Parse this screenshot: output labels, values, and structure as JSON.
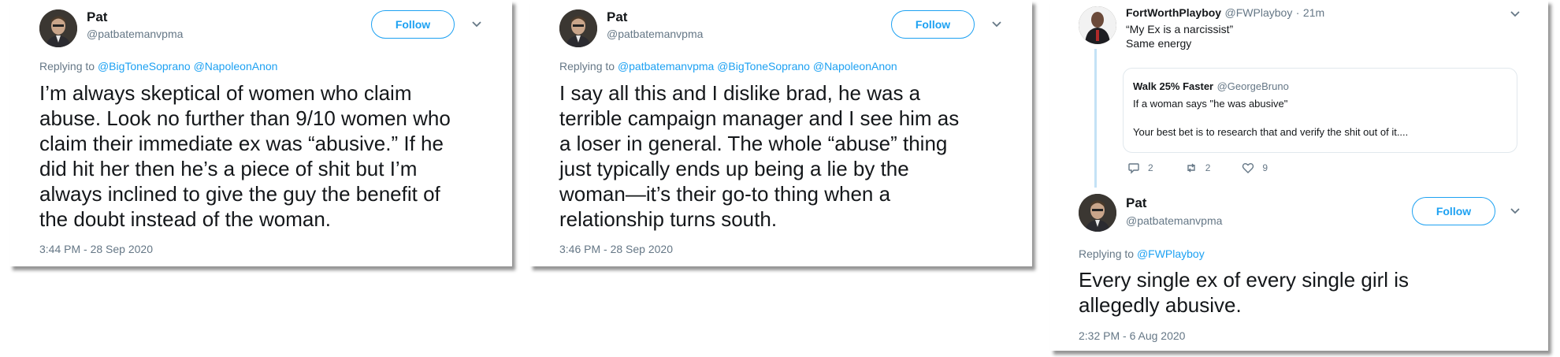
{
  "tweet1": {
    "name": "Pat",
    "handle": "@patbatemanvpma",
    "follow_label": "Follow",
    "replying_prefix": "Replying to",
    "replying_to": [
      "@BigToneSoprano",
      "@NapoleonAnon"
    ],
    "lines": [
      "I’m always skeptical of women who claim",
      "abuse. Look no further than 9/10 women who",
      "claim their immediate ex was “abusive.” If he",
      "did hit her then he’s a piece of shit but I’m",
      "always inclined to give the guy the benefit of",
      "the doubt instead of the woman."
    ],
    "timestamp": "3:44 PM - 28 Sep 2020"
  },
  "tweet2": {
    "name": "Pat",
    "handle": "@patbatemanvpma",
    "follow_label": "Follow",
    "replying_prefix": "Replying to",
    "replying_to": [
      "@patbatemanvpma",
      "@BigToneSoprano",
      "@NapoleonAnon"
    ],
    "lines": [
      "I say all this and I dislike brad, he was a",
      "terrible campaign manager and I see him as",
      "a loser in general. The whole “abuse” thing",
      "just typically ends up being a lie by the",
      "woman—it’s their go-to thing when a",
      "relationship turns south."
    ],
    "timestamp": "3:46 PM - 28 Sep 2020"
  },
  "tweet3": {
    "parent": {
      "name": "FortWorthPlayboy",
      "handle": "@FWPlayboy",
      "separator": "·",
      "age": "21m",
      "line1": "“My Ex is a narcissist”",
      "line2": "Same energy",
      "quote": {
        "name": "Walk 25% Faster",
        "handle": "@GeorgeBruno",
        "line1": "If a woman says \"he was abusive\"",
        "line2": "Your best bet is to research that and verify the shit out of it...."
      },
      "replies": "2",
      "retweets": "2",
      "likes": "9"
    },
    "name": "Pat",
    "handle": "@patbatemanvpma",
    "follow_label": "Follow",
    "replying_prefix": "Replying to",
    "replying_to": [
      "@FWPlayboy"
    ],
    "lines": [
      "Every single ex of every single girl is",
      "allegedly abusive."
    ],
    "timestamp": "2:32 PM - 6 Aug 2020"
  },
  "colors": {
    "accent": "#1da1f2",
    "secondary_text": "#657786",
    "primary_text": "#14171a",
    "thread_line": "#c4e2f6"
  }
}
